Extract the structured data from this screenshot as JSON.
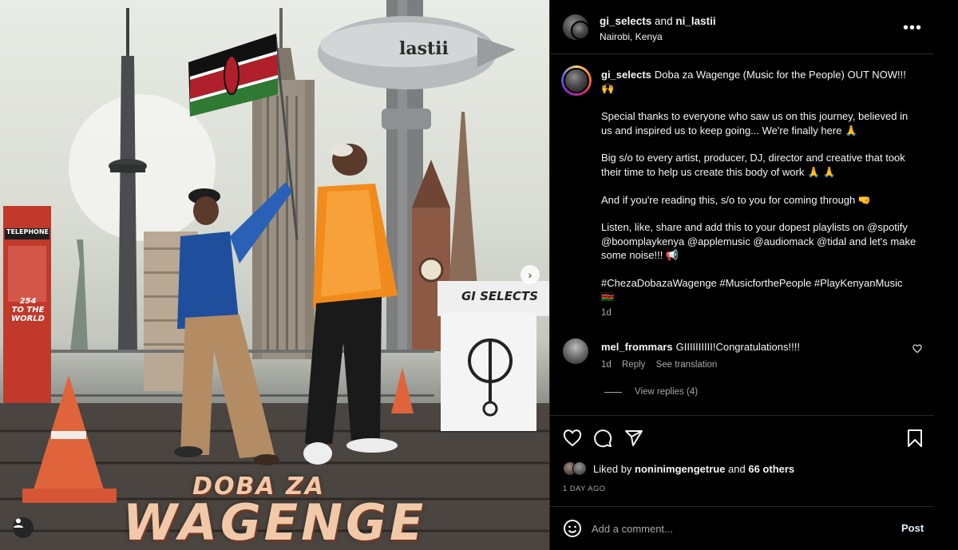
{
  "media": {
    "album_line1": "DOBA ZA",
    "album_line2": "WAGENGE",
    "blimp_text": "lastii",
    "sign_text": "GI SELECTS",
    "sticker_line1": "254",
    "sticker_line2": "TO THE",
    "sticker_line3": "WORLD",
    "booth_text": "TELEPHONE"
  },
  "header": {
    "user1": "gi_selects",
    "joiner": " and ",
    "user2": "ni_lastii",
    "location": "Nairobi, Kenya",
    "more_icon": "•••"
  },
  "caption": {
    "username": "gi_selects",
    "line1": "Doba za Wagenge (Music for the People) OUT NOW!!! 🙌",
    "p2": "Special thanks to everyone who saw us on this journey, believed in us and inspired us to keep going... We're finally here 🙏",
    "p3": "Big s/o to every artist, producer, DJ, director and creative that took their time to help us create this body of work 🙏 🙏",
    "p4": "And if you're reading this, s/o to you for coming through 🤜",
    "p5": "Listen, like, share and add this to your dopest playlists on @spotify @boomplaykenya @applemusic @audiomack @tidal and let's make some noise!!! 📢",
    "p6": "#ChezaDobazaWagenge #MusicforthePeople #PlayKenyanMusic 🇰🇪",
    "time": "1d"
  },
  "comment": {
    "username": "mel_frommars",
    "text": "GIIIIIIIIII!Congratulations!!!!",
    "time": "1d",
    "reply": "Reply",
    "translate": "See translation",
    "view_replies": "View replies (4)"
  },
  "likes": {
    "prefix": "Liked by ",
    "user": "noninimgengetrue",
    "suffix": " and ",
    "others": "66 others"
  },
  "date": "1 DAY AGO",
  "add_comment": {
    "placeholder": "Add a comment...",
    "post": "Post"
  },
  "icons": [
    "heart-icon",
    "comment-icon",
    "share-icon",
    "bookmark-icon",
    "emoji-icon",
    "tag-user-icon",
    "more-icon"
  ]
}
